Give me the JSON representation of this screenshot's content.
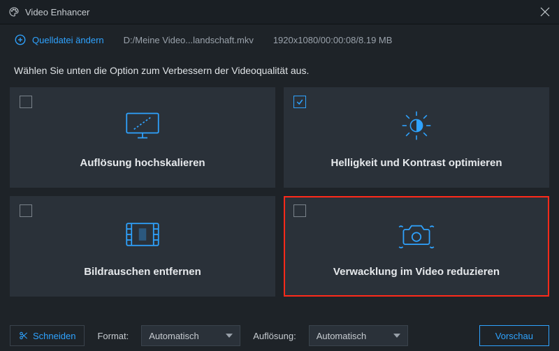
{
  "titlebar": {
    "title": "Video Enhancer"
  },
  "topbar": {
    "change_source": "Quelldatei ändern",
    "filepath": "D:/Meine Video...landschaft.mkv",
    "fileinfo": "1920x1080/00:00:08/8.19 MB"
  },
  "instruction": "Wählen Sie unten die Option zum Verbessern der Videoqualität aus.",
  "cards": {
    "upscale": {
      "label": "Auflösung hochskalieren",
      "checked": false
    },
    "brightness": {
      "label": "Helligkeit und Kontrast optimieren",
      "checked": true
    },
    "denoise": {
      "label": "Bildrauschen entfernen",
      "checked": false
    },
    "stabilize": {
      "label": "Verwacklung im Video reduzieren",
      "checked": false
    }
  },
  "bottombar": {
    "cut": "Schneiden",
    "format_label": "Format:",
    "format_value": "Automatisch",
    "resolution_label": "Auflösung:",
    "resolution_value": "Automatisch",
    "preview": "Vorschau"
  }
}
